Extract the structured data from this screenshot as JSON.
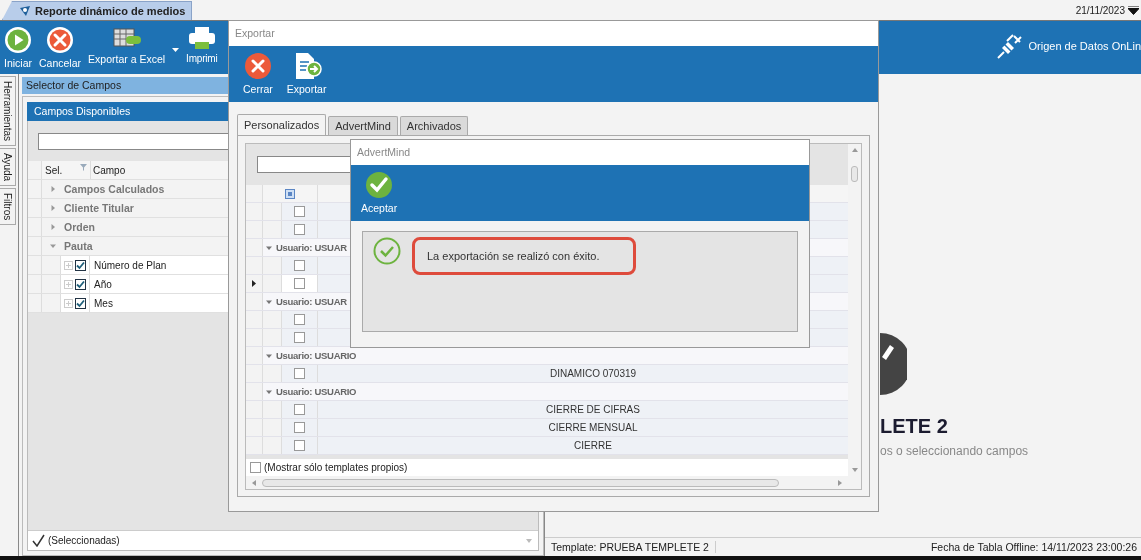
{
  "document_tab": {
    "title": "Reporte dinámico de medios"
  },
  "date": "21/11/2023",
  "ribbon": {
    "buttons": [
      {
        "label": "Iniciar",
        "kind": "play",
        "dropdown": false
      },
      {
        "label": "Cancelar",
        "kind": "cancel",
        "dropdown": false
      },
      {
        "label": "Exportar a Excel",
        "kind": "excel",
        "dropdown": true
      },
      {
        "label": "Imprimi",
        "kind": "print",
        "dropdown": false
      }
    ],
    "data_source": "Origen de Datos OnLin"
  },
  "side_tabs": [
    {
      "label": "Herramientas"
    },
    {
      "label": "Ayuda"
    },
    {
      "label": "Filtros"
    }
  ],
  "field_selector": {
    "title": "Selector de Campos",
    "panel_title": "Campos Disponibles",
    "columns": [
      "Sel.",
      "Campo"
    ],
    "groups": [
      {
        "label": "Campos Calculados",
        "expanded": false
      },
      {
        "label": "Cliente Titular",
        "expanded": false
      },
      {
        "label": "Orden",
        "expanded": false
      },
      {
        "label": "Pauta",
        "expanded": true,
        "children": [
          {
            "label": "Número de Plan",
            "checked": true
          },
          {
            "label": "Año",
            "checked": true
          },
          {
            "label": "Mes",
            "checked": true
          }
        ]
      }
    ],
    "filter": {
      "label": "(Seleccionadas)",
      "checked": true
    }
  },
  "canvas": {
    "title": "LETE 2",
    "hint": "os o seleccionando campos"
  },
  "status_bar": {
    "template": "Template: PRUEBA TEMPLETE 2",
    "offline_date": "Fecha de Tabla Offline: 14/11/2023 23:00:26"
  },
  "export_dialog": {
    "title": "Exportar",
    "toolbar": [
      {
        "label": "Cerrar",
        "kind": "close"
      },
      {
        "label": "Exportar",
        "kind": "export"
      }
    ],
    "tabs": [
      {
        "label": "Personalizados",
        "selected": true
      },
      {
        "label": "AdvertMind",
        "selected": false
      },
      {
        "label": "Archivados",
        "selected": false
      }
    ],
    "grid": {
      "select_all": {
        "indeterminate": true
      },
      "items": [
        {
          "kind": "row",
          "checked": false,
          "current": false
        },
        {
          "kind": "row",
          "checked": false,
          "current": false
        },
        {
          "kind": "group",
          "label": "Usuario: USUAR",
          "expanded": true
        },
        {
          "kind": "row",
          "checked": false,
          "current": false
        },
        {
          "kind": "row",
          "checked": false,
          "current": true
        },
        {
          "kind": "group",
          "label": "Usuario: USUAR",
          "expanded": true
        },
        {
          "kind": "row",
          "checked": false,
          "current": false
        },
        {
          "kind": "row",
          "checked": false,
          "current": false
        },
        {
          "kind": "group",
          "label": "Usuario: USUARIO",
          "expanded": true
        },
        {
          "kind": "row",
          "checked": false,
          "current": false,
          "name": "DINAMICO 070319"
        },
        {
          "kind": "group",
          "label": "Usuario: USUARIO",
          "expanded": true
        },
        {
          "kind": "row",
          "checked": false,
          "current": false,
          "name": "CIERRE DE CIFRAS"
        },
        {
          "kind": "row",
          "checked": false,
          "current": false,
          "name": "CIERRE MENSUAL"
        },
        {
          "kind": "row",
          "checked": false,
          "current": false,
          "name": "CIERRE"
        }
      ],
      "own_only": {
        "label": "(Mostrar sólo templates propios)",
        "checked": false
      }
    }
  },
  "message_dialog": {
    "title": "AdvertMind",
    "button": {
      "label": "Aceptar"
    },
    "message": "La exportación se realizó con éxito."
  }
}
